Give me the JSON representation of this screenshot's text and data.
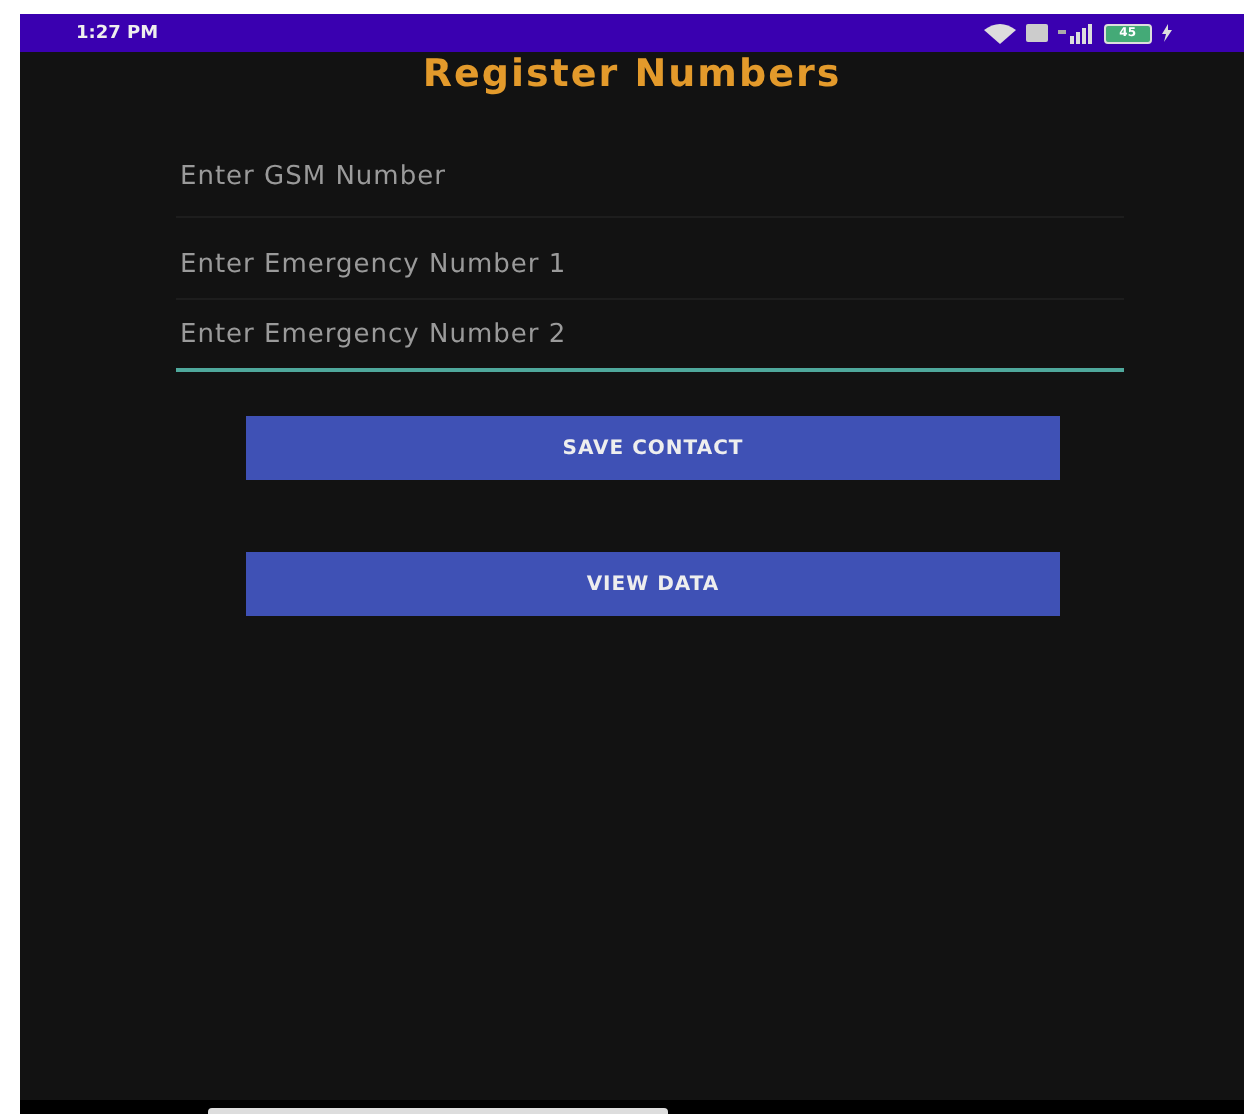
{
  "status_bar": {
    "time": "1:27 PM",
    "battery": "45"
  },
  "title": "Register Numbers",
  "fields": [
    {
      "placeholder": "Enter GSM Number",
      "focused": false
    },
    {
      "placeholder": "Enter Emergency Number 1",
      "focused": false
    },
    {
      "placeholder": "Enter Emergency Number 2",
      "focused": true
    }
  ],
  "buttons": [
    "SAVE CONTACT",
    "VIEW DATA"
  ]
}
